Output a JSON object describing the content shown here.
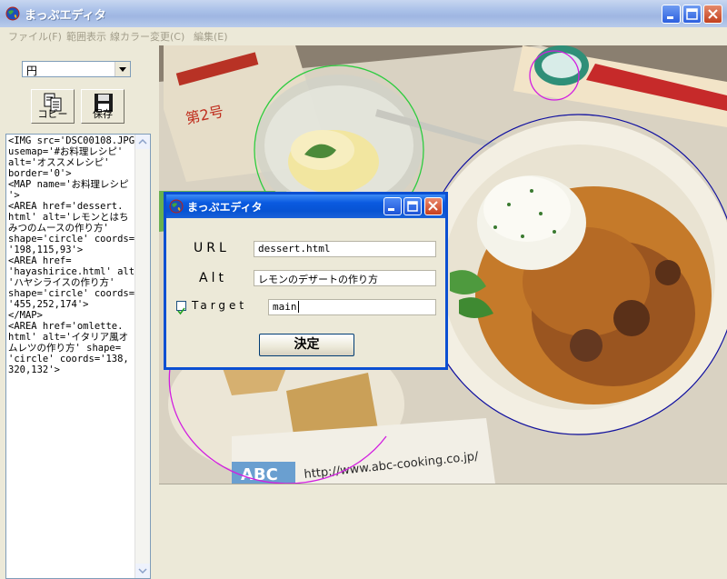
{
  "app": {
    "title": "まっぷエディタ"
  },
  "menu": [
    "ファイル(F)",
    "範囲表示",
    "線カラー変更(C)",
    "編集(E)"
  ],
  "shape_select": {
    "value": "円"
  },
  "toolbar": {
    "copy_label": "コピー",
    "save_label": "保存"
  },
  "code_lines": [
    "<IMG src='DSC00108.JPG'",
    "usemap='#お料理レシピ'",
    "alt='オススメレシピ'",
    "border='0'>",
    "<MAP name='お料理レシピ",
    "'>",
    "<AREA href='dessert.",
    "html' alt='レモンとはち",
    "みつのムースの作り方'",
    "shape='circle' coords=",
    "'198,115,93'>",
    "<AREA href=",
    "'hayashirice.html' alt=",
    "'ハヤシライスの作り方'",
    "shape='circle' coords=",
    "'455,252,174'>",
    "</MAP>",
    "<AREA href='omlette.",
    "html' alt='イタリア風オ",
    "ムレツの作り方' shape=",
    "'circle' coords='138,",
    "320,132'>"
  ],
  "dialog": {
    "title": "まっぷエディタ",
    "url_label": "URL",
    "url_value": "dessert.html",
    "alt_label": "Alt",
    "alt_value": "レモンのデザートの作り方",
    "target_label": "Target",
    "target_checked": true,
    "target_value": "main",
    "ok_label": "決定"
  },
  "photo": {
    "sign_text": "http://www.abc-cooking.co.jp/",
    "abc_text": "ABC",
    "poster_text": "第2号"
  },
  "colors": {
    "titlebar_inactive": "#a9c0e8",
    "dialog_titlebar": "#0a5ae0",
    "circle_green": "#2ecc40",
    "circle_magenta": "#d21ee0",
    "circle_blue": "#1010a0"
  }
}
